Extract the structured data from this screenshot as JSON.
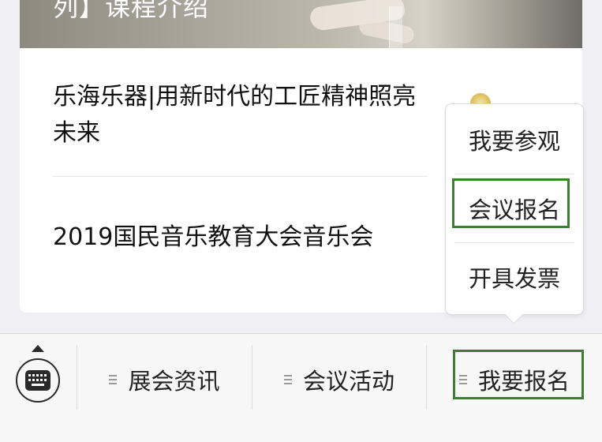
{
  "banner": {
    "title": "列】课程介绍"
  },
  "articles": [
    {
      "title": "乐海乐器|用新时代的工匠精神照亮未来"
    },
    {
      "title": "2019国民音乐教育大会音乐会"
    }
  ],
  "popup_menu": {
    "items": [
      {
        "label": "我要参观"
      },
      {
        "label": "会议报名",
        "highlighted": true
      },
      {
        "label": "开具发票"
      }
    ]
  },
  "bottom_bar": {
    "keyboard_icon": "keyboard-icon",
    "tabs": [
      {
        "label": "展会资讯"
      },
      {
        "label": "会议活动"
      },
      {
        "label": "我要报名",
        "highlighted": true
      }
    ]
  },
  "colors": {
    "highlight": "#3f7d33",
    "background": "#efeff4",
    "bottom_bar": "#f7f7f7"
  }
}
